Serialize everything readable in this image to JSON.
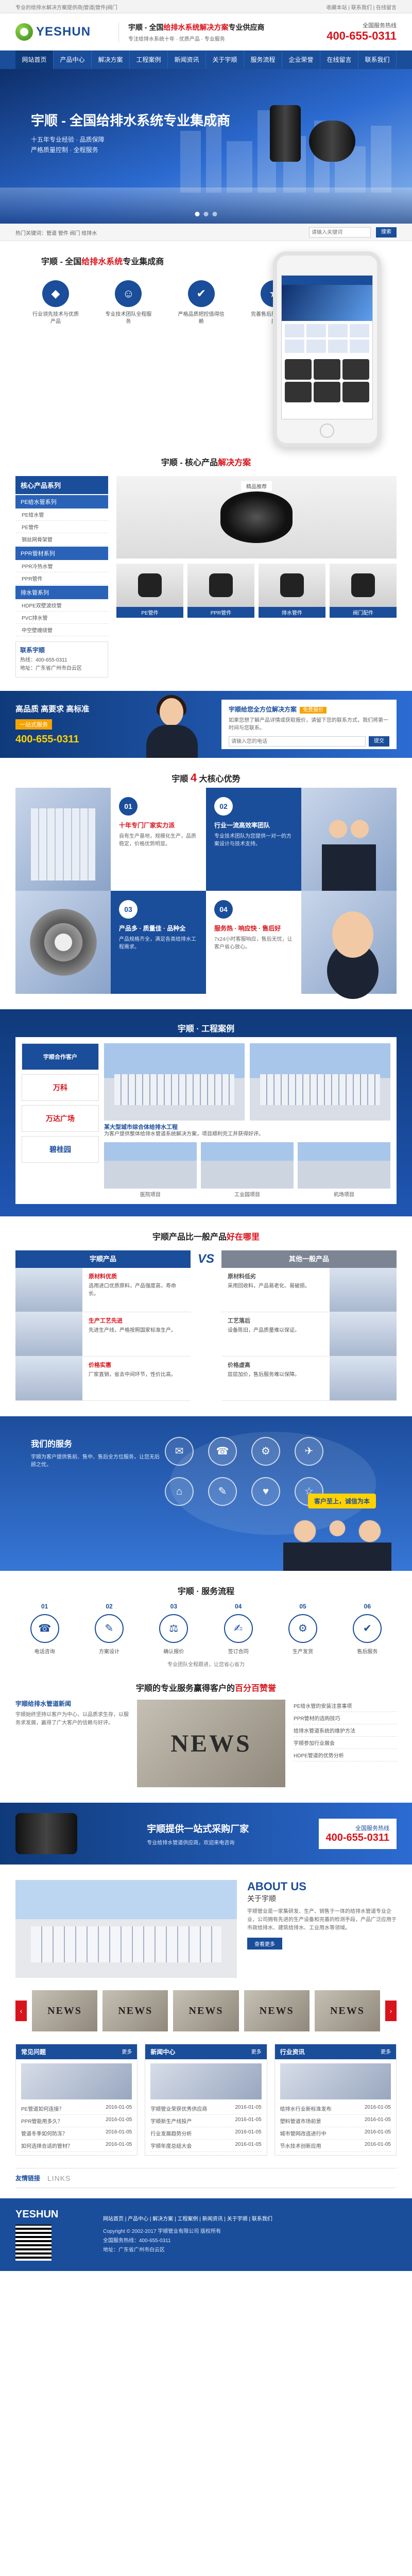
{
  "topstrip": {
    "left": "专业的给排水解决方案提供商|管道|管件|阀门",
    "right": "收藏本站 | 联系我们 | 在线留言"
  },
  "header": {
    "logo": "YESHUN",
    "slogan_pre": "宇顺 - 全国",
    "slogan_hl": "给排水系统解决方案",
    "slogan_post": "专业供应商",
    "slogan_sub": "专注给排水系统十年 · 优质产品 · 专业服务",
    "hotline_label": "全国服务热线",
    "hotline": "400-655-0311"
  },
  "nav": [
    "网站首页",
    "产品中心",
    "解决方案",
    "工程案例",
    "新闻资讯",
    "关于宇顺",
    "服务流程",
    "企业荣誉",
    "在线留言",
    "联系我们"
  ],
  "banner": {
    "title": "宇顺 - 全国给排水系统专业集成商",
    "lines": [
      "十五年专业经验 · 品质保障",
      "严格质量控制 · 全程服务"
    ]
  },
  "search": {
    "hot": "热门关键词：管道 管件 阀门 给排水",
    "placeholder": "请输入关键词",
    "button": "搜索"
  },
  "features": {
    "title_pre": "宇顺 - 全国",
    "title_hl": "给排水系统",
    "title_post": "专业集成商",
    "items": [
      {
        "icon": "◆",
        "text": "行业领先技术与优质产品"
      },
      {
        "icon": "☺",
        "text": "专业技术团队全程服务"
      },
      {
        "icon": "✔",
        "text": "严格品质把控值得信赖"
      },
      {
        "icon": "★",
        "text": "完善售后服务快速响应"
      }
    ]
  },
  "products": {
    "title_pre": "宇顺 - 核心产品",
    "title_hl": "解决方案",
    "side_head": "核心产品系列",
    "categories": [
      {
        "name": "PE给水管系列",
        "items": [
          "PE给水管",
          "PE管件",
          "钢丝网骨架管"
        ]
      },
      {
        "name": "PPR管材系列",
        "items": [
          "PPR冷热水管",
          "PPR管件"
        ]
      },
      {
        "name": "排水管系列",
        "items": [
          "HDPE双壁波纹管",
          "PVC排水管",
          "中空壁缠绕管"
        ]
      }
    ],
    "contact_title": "联系宇顺",
    "contact_lines": [
      "热线：400-655-0311",
      "地址：广东省广州市白云区"
    ],
    "featured_label": "精品推荐",
    "grid": [
      "PE管件",
      "PPR管件",
      "排水管件",
      "阀门配件"
    ]
  },
  "svc_band": {
    "t1": "高品质 高要求 高标准",
    "tag": "一站式服务",
    "phone": "400-655-0311",
    "r_title": "宇顺给您全方位解决方案",
    "r_badge": "免费报价",
    "r_text": "如果您想了解产品详情或获取报价，请留下您的联系方式，我们将第一时间与您联系。",
    "r_placeholder": "请输入您的电话",
    "r_button": "提交"
  },
  "advantages": {
    "title_pre": "宇顺",
    "title_num": "4",
    "title_post": "大核心优势",
    "items": [
      {
        "num": "01",
        "title": "十年专门厂家实力派",
        "desc": "自有生产基地，规模化生产，品质稳定，价格优势明显。"
      },
      {
        "num": "02",
        "title": "行业一流高效率团队",
        "desc": "专业技术团队为您提供一对一的方案设计与技术支持。"
      },
      {
        "num": "03",
        "title": "产品多 · 质量佳 · 品种全",
        "desc": "产品规格齐全，满足各类给排水工程需求。"
      },
      {
        "num": "04",
        "title": "服务热 · 响应快 · 售后好",
        "desc": "7x24小时客服响应，售后无忧，让客户省心放心。"
      }
    ]
  },
  "cases": {
    "title": "宇顺 · 工程案例",
    "logos": [
      "宇顺合作客户",
      "万科",
      "万达广场",
      "碧桂园"
    ],
    "big_caption_title": "某大型城市综合体给排水工程",
    "big_caption": "为客户提供整体给排水管道系统解决方案，项目顺利完工并获得好评。",
    "thumbs": [
      "医院项目",
      "工业园项目",
      "机场项目"
    ]
  },
  "vs": {
    "title_pre": "宇顺产品比一般产品",
    "title_hl": "好在哪里",
    "ours": "宇顺产品",
    "theirs": "其他一般产品",
    "mid": "VS",
    "ours_rows": [
      {
        "t": "原材料优质",
        "d": "选用进口优质原料，产品强度高，寿命长。"
      },
      {
        "t": "生产工艺先进",
        "d": "先进生产线，严格按照国家标准生产。"
      },
      {
        "t": "价格实惠",
        "d": "厂家直销，省去中间环节，性价比高。"
      }
    ],
    "theirs_rows": [
      {
        "t": "原材料低劣",
        "d": "采用回收料，产品易老化、易破损。"
      },
      {
        "t": "工艺落后",
        "d": "设备陈旧，产品质量难以保证。"
      },
      {
        "t": "价格虚高",
        "d": "层层加价，售后服务难以保障。"
      }
    ]
  },
  "oursvc": {
    "t1": "我们的服务",
    "t2": "宇顺为客户提供售前、售中、售后全方位服务，让您无后顾之忧。",
    "icons": [
      "✉",
      "☎",
      "⚙",
      "✈",
      "⌂",
      "✎",
      "♥",
      "☆"
    ],
    "bubble": "客户至上，诚信为本"
  },
  "process": {
    "title": "宇顺 · 服务流程",
    "steps": [
      {
        "n": "01",
        "icon": "☎",
        "t": "电话咨询"
      },
      {
        "n": "02",
        "icon": "✎",
        "t": "方案设计"
      },
      {
        "n": "03",
        "icon": "⚖",
        "t": "确认报价"
      },
      {
        "n": "04",
        "icon": "✍",
        "t": "签订合同"
      },
      {
        "n": "05",
        "icon": "⚙",
        "t": "生产发货"
      },
      {
        "n": "06",
        "icon": "✔",
        "t": "售后服务"
      }
    ],
    "note": "专业团队全程跟进，让您省心省力"
  },
  "news": {
    "title_pre": "宇顺的专业服务赢得客户的",
    "title_hl": "百分百赞誉",
    "lead_title": "宇顺给排水管道新闻",
    "lead_text": "宇顺始终坚持以客户为中心，以品质求生存，以服务求发展，赢得了广大客户的信赖与好评。",
    "img_text": "NEWS",
    "list": [
      "PE给水管的安装注意事项",
      "PPR管材的选购技巧",
      "给排水管道系统的维护方法",
      "宇顺参加行业展会",
      "HDPE管道的优势分析"
    ]
  },
  "cta": {
    "t1": "宇顺提供一站式采购厂家",
    "t2": "专业给排水管道供应商，欢迎来电咨询",
    "r1": "全国服务热线",
    "r2": "400-655-0311"
  },
  "about": {
    "t1": "ABOUT US",
    "t2": "关于宇顺",
    "t3": "宇顺管业是一家集研发、生产、销售于一体的给排水管道专业企业，公司拥有先进的生产设备和完善的检测手段，产品广泛应用于市政给排水、建筑给排水、工业用水等领域。",
    "more": "查看更多"
  },
  "certs": {
    "items": [
      "NEWS",
      "NEWS",
      "NEWS",
      "NEWS",
      "NEWS"
    ],
    "prev": "‹",
    "next": "›"
  },
  "bnews": [
    {
      "head": "常见问题",
      "more": "更多",
      "rows": [
        [
          "PE管道如何连接？",
          "2016-01-05"
        ],
        [
          "PPR管能用多久？",
          "2016-01-05"
        ],
        [
          "管道冬季如何防冻？",
          "2016-01-05"
        ],
        [
          "如何选择合适的管材？",
          "2016-01-05"
        ]
      ]
    },
    {
      "head": "新闻中心",
      "more": "更多",
      "rows": [
        [
          "宇顺管业荣获优秀供应商",
          "2016-01-05"
        ],
        [
          "宇顺新生产线投产",
          "2016-01-05"
        ],
        [
          "行业发展趋势分析",
          "2016-01-05"
        ],
        [
          "宇顺年度总结大会",
          "2016-01-05"
        ]
      ]
    },
    {
      "head": "行业资讯",
      "more": "更多",
      "rows": [
        [
          "给排水行业新标准发布",
          "2016-01-05"
        ],
        [
          "塑料管道市场前景",
          "2016-01-05"
        ],
        [
          "城市管网改造进行中",
          "2016-01-05"
        ],
        [
          "节水技术创新应用",
          "2016-01-05"
        ]
      ]
    }
  ],
  "links": {
    "t1": "友情链接",
    "t2": "LINKS"
  },
  "footer": {
    "logo": "YESHUN",
    "links": "网站首页 | 产品中心 | 解决方案 | 工程案例 | 新闻资讯 | 关于宇顺 | 联系我们",
    "lines": [
      "Copyright © 2002-2017 宇顺管业有限公司 版权所有",
      "全国服务热线：400-655-0311",
      "地址：广东省广州市白云区"
    ]
  }
}
